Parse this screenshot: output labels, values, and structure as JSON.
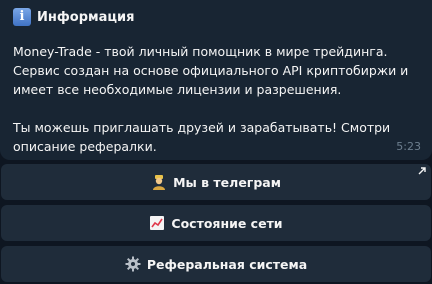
{
  "message": {
    "title": "Информация",
    "title_icon": "info-icon",
    "paragraphs": [
      "Money-Trade - твой личный помощник в мире трейдинга. Сервис создан на основе официального API криптобиржи и имеет все необходимые лицензии и разрешения.",
      "Ты можешь приглашать друзей и зарабатывать! Смотри описание рефералки."
    ],
    "time": "5:23"
  },
  "keyboard": {
    "buttons": [
      {
        "label": "Мы в телеграм",
        "icon": "person-icon",
        "has_link_arrow": true
      },
      {
        "label": "Состояние сети",
        "icon": "chart-icon",
        "has_link_arrow": false
      },
      {
        "label": "Реферальная система",
        "icon": "gear-icon",
        "has_link_arrow": false
      }
    ]
  },
  "colors": {
    "background": "#0e1621",
    "bubble": "#182533",
    "button": "#1f2c3a",
    "text": "#f5f5f5",
    "timestamp": "#6d7f8f"
  }
}
